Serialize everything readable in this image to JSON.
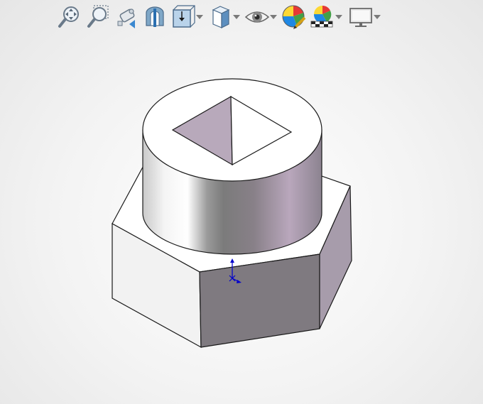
{
  "toolbar": {
    "items": [
      {
        "name": "zoom-to-fit",
        "icon": "zoom-fit-icon",
        "dropdown": false
      },
      {
        "name": "zoom-to-area",
        "icon": "zoom-area-icon",
        "dropdown": false
      },
      {
        "name": "previous-view",
        "icon": "previous-view-icon",
        "dropdown": false
      },
      {
        "name": "section-view",
        "icon": "section-view-icon",
        "dropdown": false
      },
      {
        "name": "view-orientation",
        "icon": "view-orientation-icon",
        "dropdown": true
      },
      {
        "name": "display-style",
        "icon": "display-style-icon",
        "dropdown": true
      },
      {
        "name": "hide-show-items",
        "icon": "eye-icon",
        "dropdown": true
      },
      {
        "name": "edit-appearance",
        "icon": "edit-appearance-icon",
        "dropdown": false
      },
      {
        "name": "apply-scene",
        "icon": "apply-scene-icon",
        "dropdown": true
      },
      {
        "name": "view-settings",
        "icon": "monitor-icon",
        "dropdown": true
      }
    ]
  },
  "colors": {
    "face_light": "#f2f2f2",
    "face_dark": "#7f7a80",
    "face_purple": "#a79cab",
    "edge": "#1a1a1a",
    "triad": "#0000cc"
  }
}
